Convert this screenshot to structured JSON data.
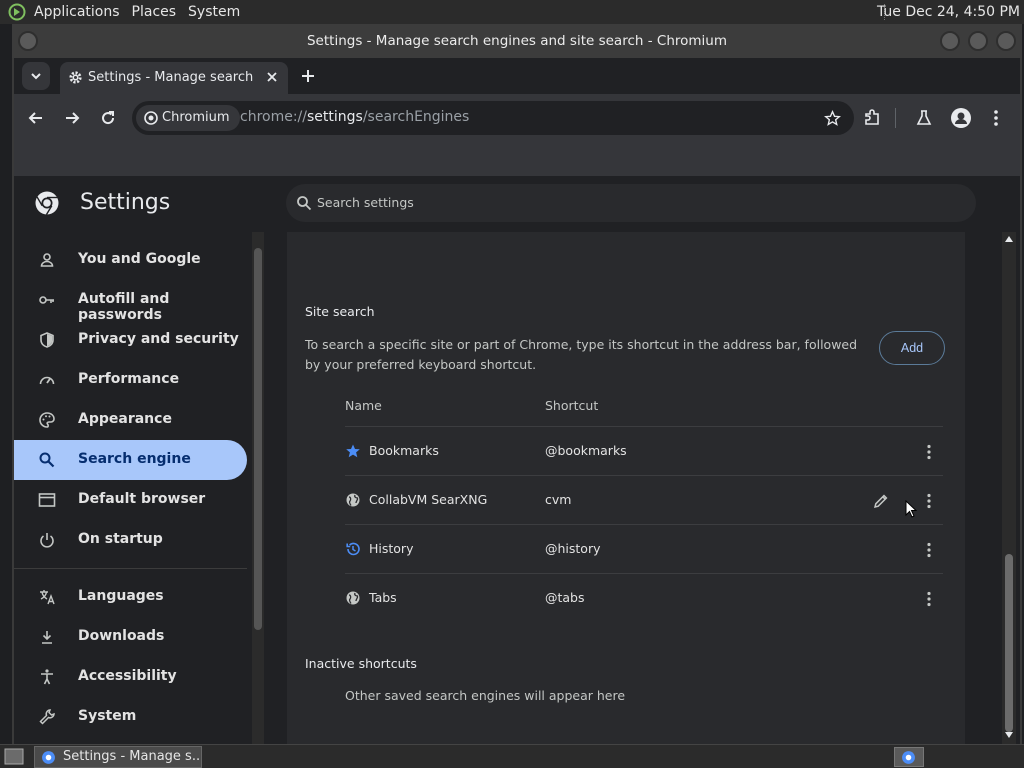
{
  "panel": {
    "menus": [
      "Applications",
      "Places",
      "System"
    ],
    "clock": "Tue Dec 24,  4:50 PM"
  },
  "window": {
    "title": "Settings - Manage search engines and site search - Chromium"
  },
  "browser": {
    "tab_title": "Settings - Manage search engines and site search",
    "site_chip": "Chromium",
    "url_prefix": "chrome://",
    "url_host": "settings",
    "url_path": "/searchEngines"
  },
  "settings": {
    "title": "Settings",
    "search_placeholder": "Search settings",
    "nav": [
      {
        "label": "You and Google",
        "icon": "person-icon"
      },
      {
        "label": "Autofill and passwords",
        "icon": "key-icon"
      },
      {
        "label": "Privacy and security",
        "icon": "shield-icon"
      },
      {
        "label": "Performance",
        "icon": "speedometer-icon"
      },
      {
        "label": "Appearance",
        "icon": "palette-icon"
      },
      {
        "label": "Search engine",
        "icon": "search-icon",
        "active": true
      },
      {
        "label": "Default browser",
        "icon": "browser-window-icon"
      },
      {
        "label": "On startup",
        "icon": "power-icon"
      },
      {
        "label": "Languages",
        "icon": "translate-icon"
      },
      {
        "label": "Downloads",
        "icon": "download-icon"
      },
      {
        "label": "Accessibility",
        "icon": "accessibility-icon"
      },
      {
        "label": "System",
        "icon": "wrench-icon"
      }
    ],
    "site_search": {
      "heading": "Site search",
      "description": "To search a specific site or part of Chrome, type its shortcut in the address bar, followed by your preferred keyboard shortcut.",
      "add_label": "Add",
      "columns": [
        "Name",
        "Shortcut"
      ],
      "rows": [
        {
          "name": "Bookmarks",
          "shortcut": "@bookmarks",
          "icon": "star-icon"
        },
        {
          "name": "CollabVM SearXNG",
          "shortcut": "cvm",
          "icon": "globe-icon",
          "editable": true
        },
        {
          "name": "History",
          "shortcut": "@history",
          "icon": "history-icon"
        },
        {
          "name": "Tabs",
          "shortcut": "@tabs",
          "icon": "globe-icon"
        }
      ]
    },
    "inactive": {
      "heading": "Inactive shortcuts",
      "empty_text": "Other saved search engines will appear here"
    }
  },
  "taskbar": {
    "task_label": "Settings - Manage s..."
  },
  "colors": {
    "accent": "#a8c7fa",
    "background": "#202124",
    "card": "#292a2d"
  }
}
